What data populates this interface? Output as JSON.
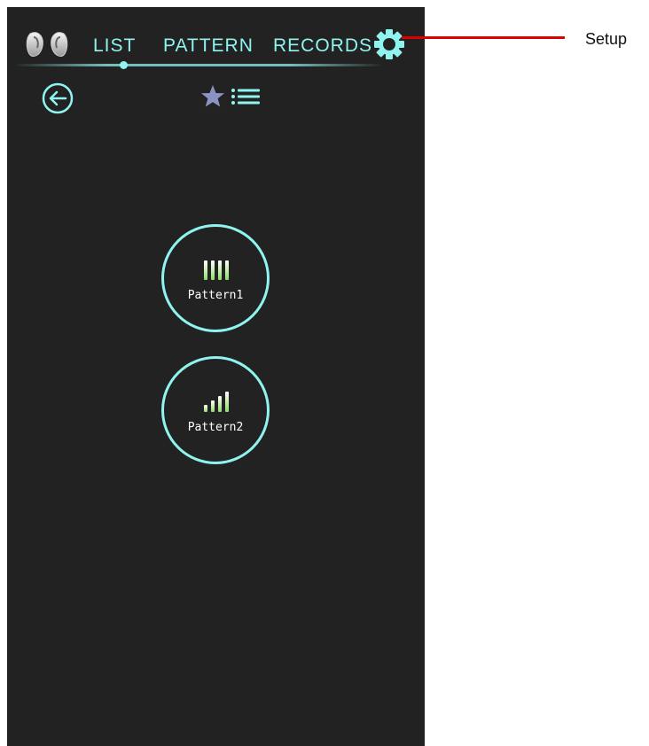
{
  "nav": {
    "tabs": [
      {
        "label": "LIST"
      },
      {
        "label": "PATTERN"
      },
      {
        "label": "RECORDS"
      }
    ],
    "settings_icon": "gear-icon",
    "device_icon": "earbuds-icon"
  },
  "toolbar": {
    "back_icon": "back-arrow-circle-icon",
    "favorites_icon": "star-list-icon"
  },
  "patterns": [
    {
      "label": "Pattern1",
      "icon": "equal-bars-icon"
    },
    {
      "label": "Pattern2",
      "icon": "ascending-bars-icon"
    }
  ],
  "callout": {
    "label": "Setup"
  },
  "colors": {
    "background": "#222222",
    "accent": "#8ff4ef",
    "bar_gradient_top": "#ffffff",
    "bar_gradient_bottom": "#8fdc6a",
    "star": "#8a93c4",
    "callout_line": "#e00000"
  }
}
